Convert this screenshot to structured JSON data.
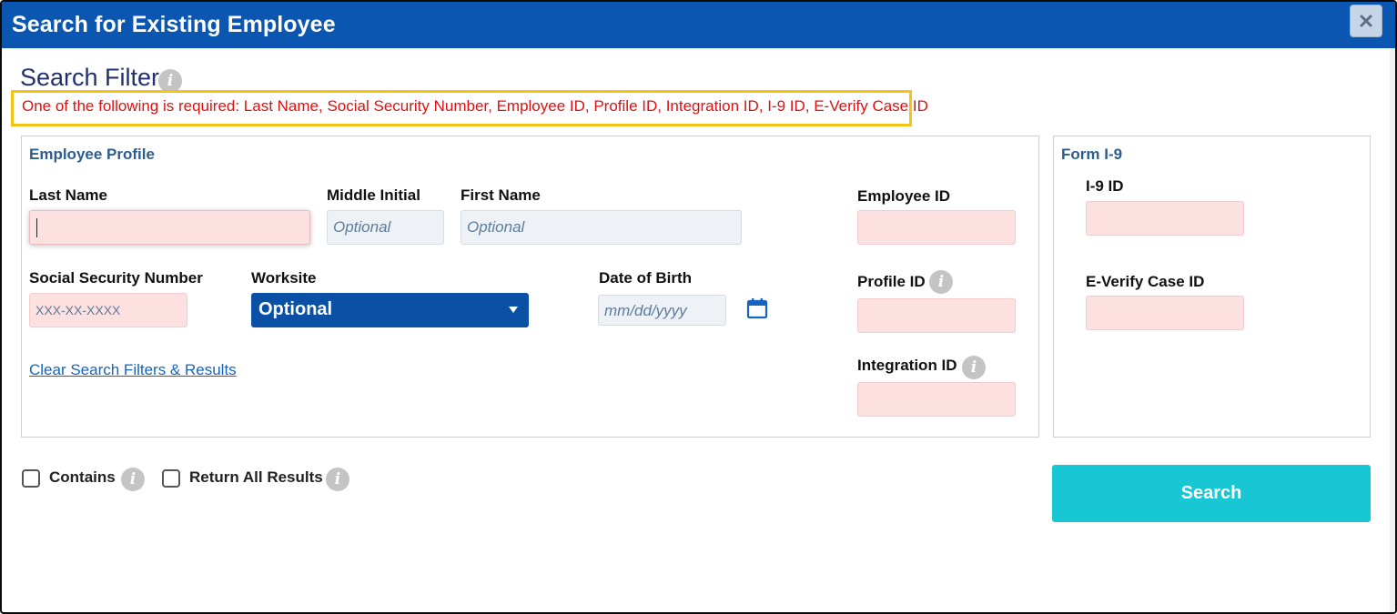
{
  "dialog": {
    "title": "Search for Existing Employee",
    "close_icon": "close-icon"
  },
  "filter": {
    "heading": "Search Filter",
    "info_glyph": "i",
    "requirement": "One of the following is required: Last Name, Social Security Number, Employee ID, Profile ID, Integration ID, I-9 ID, E-Verify Case ID"
  },
  "profile": {
    "title": "Employee Profile",
    "last_name_label": "Last Name",
    "last_name_value": "",
    "middle_initial_label": "Middle Initial",
    "middle_initial_placeholder": "Optional",
    "first_name_label": "First Name",
    "first_name_placeholder": "Optional",
    "ssn_label": "Social Security Number",
    "ssn_placeholder": "XXX-XX-XXXX",
    "worksite_label": "Worksite",
    "worksite_value": "Optional",
    "dob_label": "Date of Birth",
    "dob_placeholder": "mm/dd/yyyy",
    "employee_id_label": "Employee ID",
    "profile_id_label": "Profile ID",
    "integration_id_label": "Integration ID",
    "clear_link": "Clear Search Filters & Results"
  },
  "form_i9": {
    "title": "Form I-9",
    "i9_id_label": "I-9 ID",
    "everify_label": "E-Verify Case ID"
  },
  "options": {
    "contains_label": "Contains",
    "contains_checked": false,
    "return_all_label": "Return All Results",
    "return_all_checked": false
  },
  "actions": {
    "search_label": "Search"
  },
  "colors": {
    "titlebar": "#0a56b0",
    "required_field": "#fde0e0",
    "required_text": "#dd1212",
    "highlight_border": "#f3c316",
    "search_button": "#17c8d4"
  }
}
